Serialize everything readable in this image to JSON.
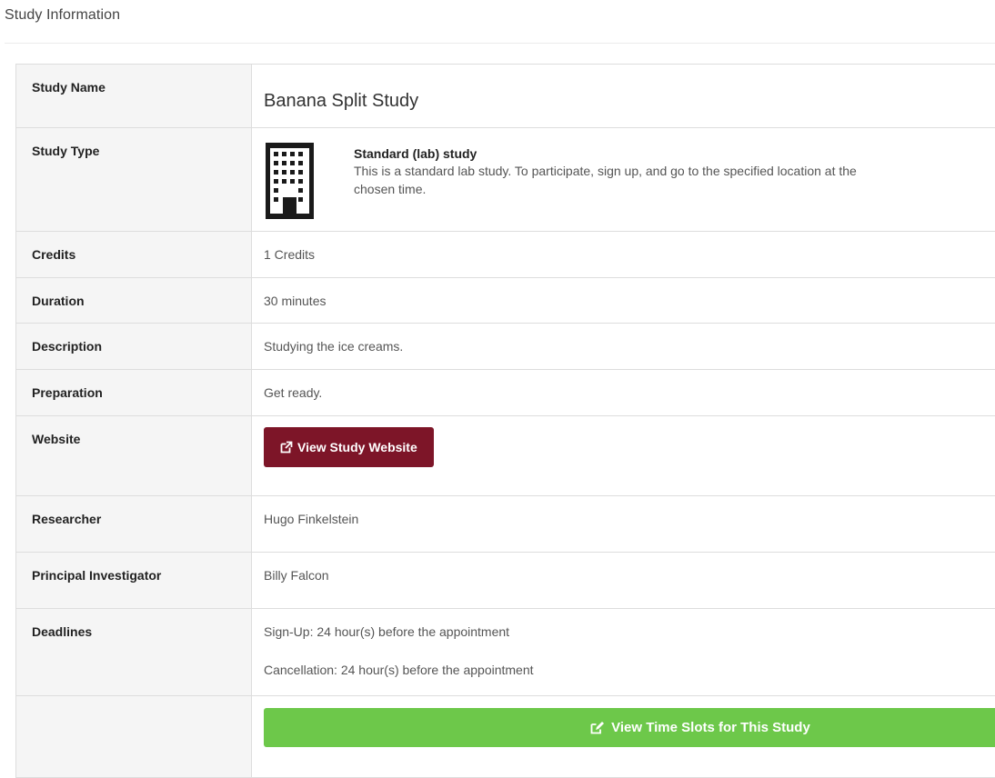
{
  "section": {
    "title": "Study Information"
  },
  "rows": {
    "study_name": {
      "label": "Study Name",
      "value": "Banana Split Study"
    },
    "study_type": {
      "label": "Study Type",
      "type_title": "Standard (lab) study",
      "type_desc": "This is a standard lab study. To participate, sign up, and go to the specified location at the chosen time.",
      "icon": "building-icon"
    },
    "credits": {
      "label": "Credits",
      "value": "1 Credits"
    },
    "duration": {
      "label": "Duration",
      "value": "30 minutes"
    },
    "description": {
      "label": "Description",
      "value": "Studying the ice creams."
    },
    "preparation": {
      "label": "Preparation",
      "value": "Get ready."
    },
    "website": {
      "label": "Website",
      "button_label": "View Study Website",
      "icon": "external-link-icon"
    },
    "researcher": {
      "label": "Researcher",
      "value": "Hugo Finkelstein"
    },
    "pi": {
      "label": "Principal Investigator",
      "value": "Billy Falcon"
    },
    "deadlines": {
      "label": "Deadlines",
      "signup": "Sign-Up:  24 hour(s) before the appointment",
      "cancellation": "Cancellation:  24 hour(s) before the appointment"
    },
    "actions": {
      "timeslots_label": "View Time Slots for This Study",
      "icon": "edit-icon"
    }
  },
  "colors": {
    "website_button": "#7d1528",
    "timeslots_button": "#6dc84a",
    "label_bg": "#f5f5f5",
    "border": "#dddddd"
  }
}
